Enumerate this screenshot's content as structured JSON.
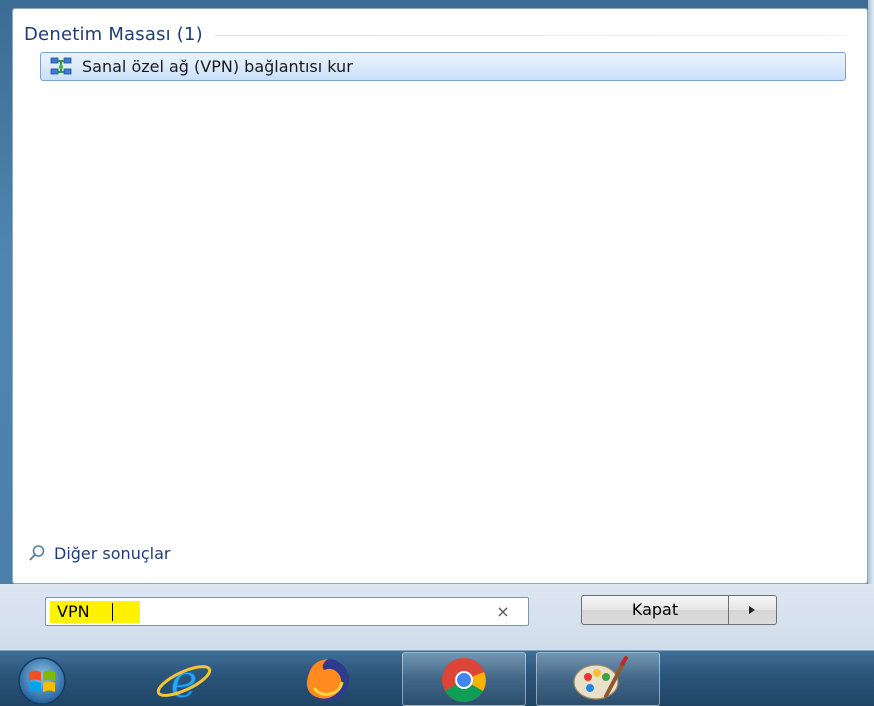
{
  "start_menu": {
    "group": {
      "title": "Denetim Masası (1)",
      "items": [
        {
          "label": "Sanal özel ağ (VPN) bağlantısı kur",
          "icon": "network-connection-icon"
        }
      ]
    },
    "more_results": {
      "label": "Diğer sonuçlar",
      "icon": "search-icon"
    },
    "search": {
      "value": "VPN",
      "clear_icon": "×"
    },
    "shutdown": {
      "label": "Kapat",
      "arrow_icon": "chevron-right-icon"
    }
  },
  "taskbar": {
    "items": [
      {
        "name": "start-orb",
        "icon": "windows-orb-icon"
      },
      {
        "name": "internet-explorer",
        "icon": "internet-explorer-icon"
      },
      {
        "name": "firefox",
        "icon": "firefox-icon"
      },
      {
        "name": "chrome",
        "icon": "chrome-icon"
      },
      {
        "name": "paint",
        "icon": "paint-icon"
      }
    ]
  },
  "colors": {
    "search_highlight": "#fff200",
    "group_title": "#1e3c78",
    "selected_item_bg": "#dcebfc",
    "taskbar": "#2a5479"
  }
}
